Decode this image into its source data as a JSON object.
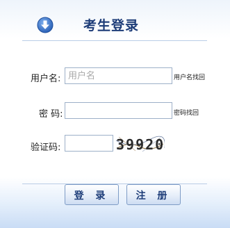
{
  "header": {
    "title": "考生登录",
    "icon": "arrow-down-circle-icon"
  },
  "form": {
    "username": {
      "label": "用户名:",
      "placeholder": "用户名",
      "value": "",
      "link": "用户名找回"
    },
    "password": {
      "label": "密 码:",
      "value": "",
      "link": "密码找回"
    },
    "captcha": {
      "label": "验证码:",
      "value": "",
      "image_text": "39920"
    }
  },
  "buttons": {
    "login": "登 录",
    "register": "注 册"
  },
  "colors": {
    "title": "#1d3c78",
    "accent": "#3a73c6",
    "border": "#9db0c8"
  }
}
